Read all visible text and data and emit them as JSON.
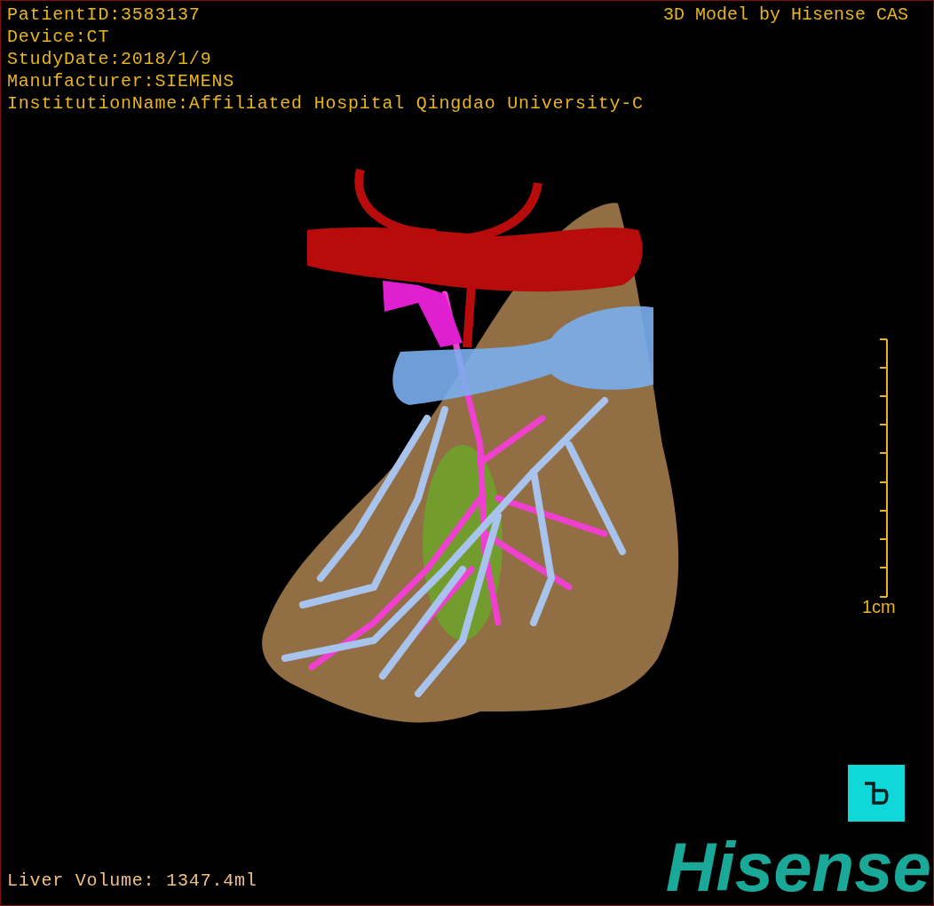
{
  "viewer": {
    "info_lines": [
      "PatientID:3583137",
      "Device:CT",
      "StudyDate:2018/1/9",
      "Manufacturer:SIEMENS",
      "InstitutionName:Affiliated Hospital Qingdao University-C"
    ],
    "model_credit": "3D Model by Hisense CAS",
    "scale_label": "1cm",
    "volume": "Liver Volume: 1347.4ml",
    "logo": "Hisense"
  }
}
